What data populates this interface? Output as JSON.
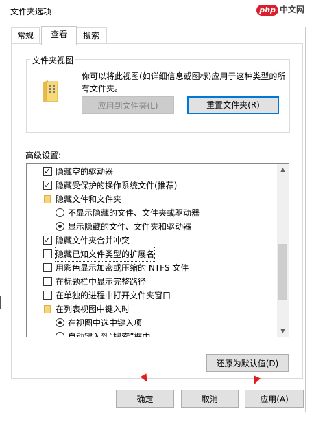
{
  "window": {
    "title": "文件夹选项"
  },
  "watermark": {
    "badge": "php",
    "text": "中文网"
  },
  "tabs": [
    {
      "label": "常规"
    },
    {
      "label": "查看",
      "selected": true
    },
    {
      "label": "搜索"
    }
  ],
  "folder_views": {
    "group_title": "文件夹视图",
    "description": "你可以将此视图(如详细信息或图标)应用于这种类型的所有文件夹。",
    "apply_button": "应用到文件夹(L)",
    "reset_button": "重置文件夹(R)"
  },
  "advanced": {
    "label": "高级设置:",
    "items": [
      {
        "kind": "checkbox",
        "checked": true,
        "label": "隐藏空的驱动器"
      },
      {
        "kind": "checkbox",
        "checked": true,
        "label": "隐藏受保护的操作系统文件(推荐)"
      },
      {
        "kind": "folder",
        "label": "隐藏文件和文件夹"
      },
      {
        "kind": "radio",
        "checked": false,
        "label": "不显示隐藏的文件、文件夹或驱动器"
      },
      {
        "kind": "radio",
        "checked": true,
        "label": "显示隐藏的文件、文件夹和驱动器"
      },
      {
        "kind": "checkbox",
        "checked": true,
        "label": "隐藏文件夹合并冲突"
      },
      {
        "kind": "checkbox",
        "checked": false,
        "label": "隐藏已知文件类型的扩展名",
        "focused": true
      },
      {
        "kind": "checkbox",
        "checked": false,
        "label": "用彩色显示加密或压缩的 NTFS 文件"
      },
      {
        "kind": "checkbox",
        "checked": false,
        "label": "在标题栏中显示完整路径"
      },
      {
        "kind": "checkbox",
        "checked": false,
        "label": "在单独的进程中打开文件夹窗口"
      },
      {
        "kind": "folder",
        "label": "在列表视图中键入时"
      },
      {
        "kind": "radio",
        "checked": true,
        "label": "在视图中选中键入项"
      },
      {
        "kind": "radio",
        "checked": false,
        "label": "自动键入到“搜索”框中"
      }
    ],
    "restore_button": "还原为默认值(D)"
  },
  "footer": {
    "ok": "确定",
    "cancel": "取消",
    "apply": "应用(A)"
  },
  "colors": {
    "accent": "#0078d7",
    "annotation_arrow": "#e02020"
  }
}
